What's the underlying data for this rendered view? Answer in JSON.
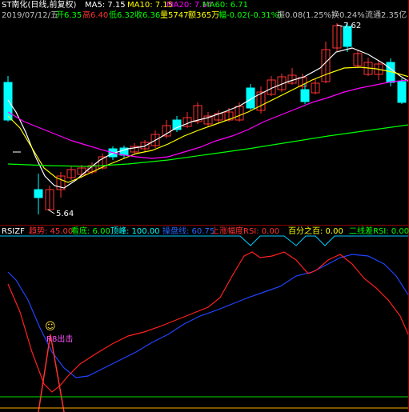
{
  "header": {
    "stock": "ST南化(日线,前复权)",
    "ma5": "MA5: 7.15",
    "ma10": "MA10: 7.15",
    "ma20": "MA20: 7.14",
    "ma60": "MA60: 6.71"
  },
  "info": {
    "date": "2019/07/12/五",
    "open": "开6.35",
    "high": "高6.40",
    "low": "低6.32",
    "close": "收6.36",
    "volume": "量5747",
    "amount": "额365万",
    "change": "幅-0.02(-0.31%)",
    "amplitude": "振0.08(1.25%)",
    "turnover": "换0.24%",
    "float": "流通2.35亿"
  },
  "price_labels": {
    "high": "7.62",
    "low": "5.64"
  },
  "indicator": {
    "name": "RSIZF",
    "trend": "趋势: 45.00",
    "bottom": "看底: 6.00",
    "top": "顶峰: 100.00",
    "ban": "操盘线: 60.75",
    "up_rsi": "上涨幅度RSI: 0.00",
    "hundred": "百分之百: 0.00",
    "two_line": "二线差RSI: 0.00",
    "signal": "R8出击"
  },
  "colors": {
    "bg": "#000000",
    "up": "#ff3232",
    "down": "#00ffff",
    "ma5": "#ffffff",
    "ma10": "#ffff00",
    "ma20": "#ff00ff",
    "ma60": "#00ff00",
    "rsi_red": "#ff2020",
    "rsi_blue": "#2244ff"
  }
}
